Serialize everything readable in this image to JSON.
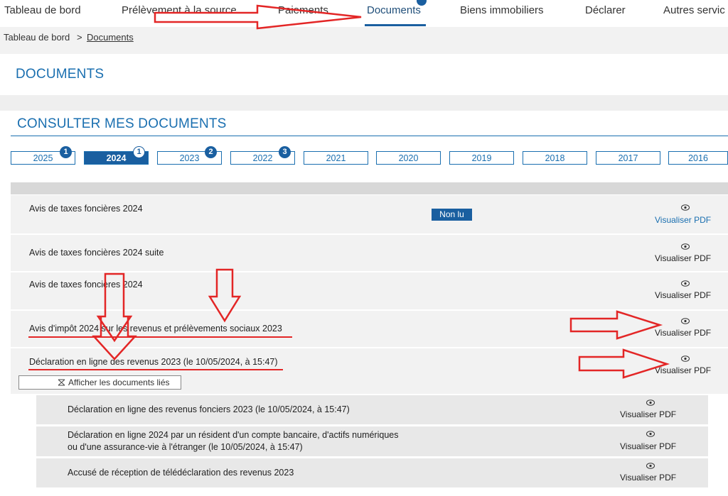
{
  "nav": {
    "items": [
      {
        "label": "Tableau de bord"
      },
      {
        "label": "Prélèvement à la source"
      },
      {
        "label": "Paiements"
      },
      {
        "label": "Documents"
      },
      {
        "label": "Biens immobiliers"
      },
      {
        "label": "Déclarer"
      },
      {
        "label": "Autres servic"
      }
    ],
    "active": "Documents",
    "accent": "#1a5fa0"
  },
  "breadcrumb": {
    "home": "Tableau de bord",
    "separator": ">",
    "current": "Documents"
  },
  "page_title": "DOCUMENTS",
  "section_title": "CONSULTER MES DOCUMENTS",
  "years": [
    {
      "label": "2025",
      "badge": "1"
    },
    {
      "label": "2024",
      "badge": "1",
      "active": true
    },
    {
      "label": "2023",
      "badge": "2"
    },
    {
      "label": "2022",
      "badge": "3"
    },
    {
      "label": "2021"
    },
    {
      "label": "2020"
    },
    {
      "label": "2019"
    },
    {
      "label": "2018"
    },
    {
      "label": "2017"
    },
    {
      "label": "2016"
    }
  ],
  "documents": [
    {
      "title": "Avis de taxes foncières 2024",
      "status": "Non lu",
      "action": "Visualiser PDF"
    },
    {
      "title": "Avis de taxes foncières 2024 suite",
      "action": "Visualiser PDF"
    },
    {
      "title": "Avis de taxes foncières 2024",
      "action": "Visualiser PDF"
    },
    {
      "title": "Avis d'impôt 2024 sur les revenus et prélèvements sociaux 2023",
      "action": "Visualiser PDF"
    },
    {
      "title": "Déclaration en ligne des revenus 2023 (le 10/05/2024, à 15:47)",
      "action": "Visualiser PDF"
    }
  ],
  "related_toggle": "Afficher les documents liés",
  "related_documents": [
    {
      "title_lines": [
        "Déclaration en ligne des revenus fonciers 2023 (le 10/05/2024, à 15:47)"
      ],
      "action": "Visualiser PDF"
    },
    {
      "title_lines": [
        "Déclaration en ligne 2024 par un résident d'un compte bancaire, d'actifs numériques",
        "ou d'une assurance-vie à l'étranger (le 10/05/2024, à 15:47)"
      ],
      "action": "Visualiser PDF"
    },
    {
      "title_lines": [
        "Accusé de réception de télédéclaration des revenus 2023"
      ],
      "action": "Visualiser PDF"
    }
  ],
  "icons": {
    "eye": "eye-icon",
    "collapse": "collapse-icon"
  },
  "colors": {
    "title_blue": "#1a6fb0",
    "annotation_red": "#e32626",
    "badge": "#1a5fa0"
  }
}
